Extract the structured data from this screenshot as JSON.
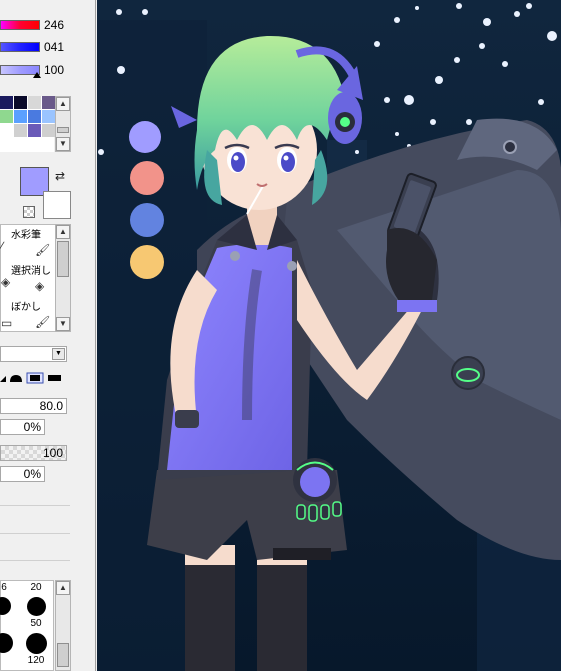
{
  "color_panel": {
    "sliders": [
      {
        "name": "hue",
        "value": "246",
        "level": 0.96
      },
      {
        "name": "saturation",
        "value": "041",
        "level": 0.16
      },
      {
        "name": "value",
        "value": "100",
        "level": 1.0
      }
    ],
    "swatches": [
      "#1b1b5e",
      "#0a0a2a",
      "#d8d8d8",
      "#6a5a8a",
      "#8fd88f",
      "#5aa0ff",
      "#4a7ae0",
      "#9ac4ff",
      "#ffffff",
      "#d0d0d0",
      "#6a5ab8",
      "#cfcfcf"
    ],
    "main_color": "#a09cff",
    "sub_color": "#ffffff"
  },
  "tools": {
    "items": [
      {
        "label": "水彩筆",
        "icon": "watercolor-brush-icon"
      },
      {
        "label": "選択消し",
        "icon": "select-eraser-icon"
      },
      {
        "label": "ぼかし",
        "icon": "blur-brush-icon"
      }
    ]
  },
  "brush_settings": {
    "blend_mode": "",
    "brush_size": "80.0",
    "min_size": "0%",
    "density": "100",
    "min_density": "0%"
  },
  "brush_sizes": {
    "labels": [
      "6",
      "20",
      "",
      "50",
      "",
      "120"
    ]
  },
  "canvas": {
    "palette_colors": [
      "#a09cff",
      "#f2938a",
      "#6283e0",
      "#f7c872"
    ],
    "background": "#0b1e33"
  }
}
